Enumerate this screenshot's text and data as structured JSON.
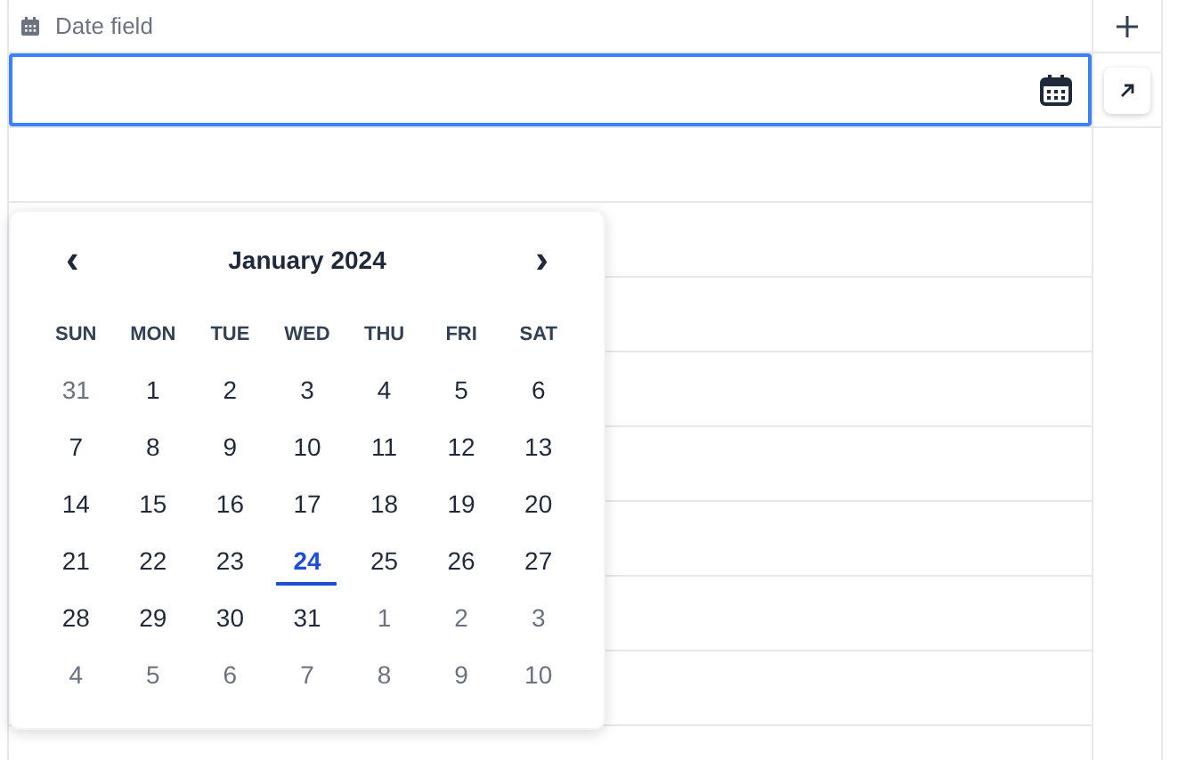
{
  "column": {
    "title": "Date field"
  },
  "calendar": {
    "month_title": "January 2024",
    "prev": "‹",
    "next": "›",
    "weekdays": [
      "SUN",
      "MON",
      "TUE",
      "WED",
      "THU",
      "FRI",
      "SAT"
    ],
    "days": [
      {
        "day": "31",
        "outside": true,
        "today": false
      },
      {
        "day": "1",
        "outside": false,
        "today": false
      },
      {
        "day": "2",
        "outside": false,
        "today": false
      },
      {
        "day": "3",
        "outside": false,
        "today": false
      },
      {
        "day": "4",
        "outside": false,
        "today": false
      },
      {
        "day": "5",
        "outside": false,
        "today": false
      },
      {
        "day": "6",
        "outside": false,
        "today": false
      },
      {
        "day": "7",
        "outside": false,
        "today": false
      },
      {
        "day": "8",
        "outside": false,
        "today": false
      },
      {
        "day": "9",
        "outside": false,
        "today": false
      },
      {
        "day": "10",
        "outside": false,
        "today": false
      },
      {
        "day": "11",
        "outside": false,
        "today": false
      },
      {
        "day": "12",
        "outside": false,
        "today": false
      },
      {
        "day": "13",
        "outside": false,
        "today": false
      },
      {
        "day": "14",
        "outside": false,
        "today": false
      },
      {
        "day": "15",
        "outside": false,
        "today": false
      },
      {
        "day": "16",
        "outside": false,
        "today": false
      },
      {
        "day": "17",
        "outside": false,
        "today": false
      },
      {
        "day": "18",
        "outside": false,
        "today": false
      },
      {
        "day": "19",
        "outside": false,
        "today": false
      },
      {
        "day": "20",
        "outside": false,
        "today": false
      },
      {
        "day": "21",
        "outside": false,
        "today": false
      },
      {
        "day": "22",
        "outside": false,
        "today": false
      },
      {
        "day": "23",
        "outside": false,
        "today": false
      },
      {
        "day": "24",
        "outside": false,
        "today": true
      },
      {
        "day": "25",
        "outside": false,
        "today": false
      },
      {
        "day": "26",
        "outside": false,
        "today": false
      },
      {
        "day": "27",
        "outside": false,
        "today": false
      },
      {
        "day": "28",
        "outside": false,
        "today": false
      },
      {
        "day": "29",
        "outside": false,
        "today": false
      },
      {
        "day": "30",
        "outside": false,
        "today": false
      },
      {
        "day": "31",
        "outside": false,
        "today": false
      },
      {
        "day": "1",
        "outside": true,
        "today": false
      },
      {
        "day": "2",
        "outside": true,
        "today": false
      },
      {
        "day": "3",
        "outside": true,
        "today": false
      },
      {
        "day": "4",
        "outside": true,
        "today": false
      },
      {
        "day": "5",
        "outside": true,
        "today": false
      },
      {
        "day": "6",
        "outside": true,
        "today": false
      },
      {
        "day": "7",
        "outside": true,
        "today": false
      },
      {
        "day": "8",
        "outside": true,
        "today": false
      },
      {
        "day": "9",
        "outside": true,
        "today": false
      },
      {
        "day": "10",
        "outside": true,
        "today": false
      }
    ]
  }
}
